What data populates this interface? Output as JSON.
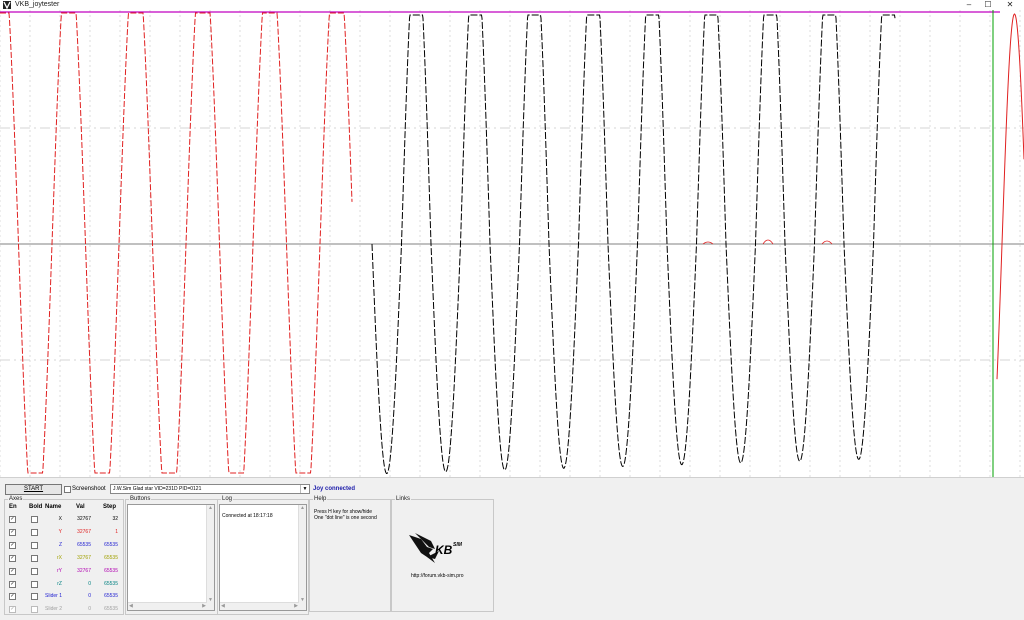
{
  "window": {
    "title": "VKB_joytester",
    "controls": [
      "–",
      "☐",
      "✕"
    ]
  },
  "plot": {
    "background": "#ffffff",
    "grid_color": "#c8c8c8",
    "axis_color": "#808080",
    "top_line_color": "#c000c0",
    "red_trace": "#e02020",
    "black_trace": "#000000",
    "cursor_color": "#00a000"
  },
  "toolbar": {
    "start_label": "START",
    "screenshot_label": "Screenshoot",
    "device_value": "J.W.Sim Glad star  VID=231D PID=0121",
    "status": "Joy connected"
  },
  "axes": {
    "title": "Axes",
    "headers": {
      "en": "En",
      "bold": "Bold",
      "name": "Name",
      "val": "Val",
      "step": "Step"
    },
    "rows": [
      {
        "en": "✓",
        "bold": "",
        "name": "X",
        "val": "32767",
        "step": "32",
        "color": "#000000",
        "disabled": false
      },
      {
        "en": "✓",
        "bold": "",
        "name": "Y",
        "val": "32767",
        "step": "1",
        "color": "#e02020",
        "disabled": false
      },
      {
        "en": "✓",
        "bold": "",
        "name": "Z",
        "val": "65535",
        "step": "65535",
        "color": "#1a1ad0",
        "disabled": false
      },
      {
        "en": "✓",
        "bold": "",
        "name": "rX",
        "val": "32767",
        "step": "65535",
        "color": "#a0a000",
        "disabled": false
      },
      {
        "en": "✓",
        "bold": "",
        "name": "rY",
        "val": "32767",
        "step": "65535",
        "color": "#b000b0",
        "disabled": false
      },
      {
        "en": "✓",
        "bold": "",
        "name": "rZ",
        "val": "0",
        "step": "65535",
        "color": "#008080",
        "disabled": false
      },
      {
        "en": "✓",
        "bold": "",
        "name": "Slider 1",
        "val": "0",
        "step": "65535",
        "color": "#1a1ad0",
        "disabled": false
      },
      {
        "en": "✓",
        "bold": "",
        "name": "Slider 2",
        "val": "0",
        "step": "65535",
        "color": "#a0a0a0",
        "disabled": true
      }
    ]
  },
  "buttons_group": {
    "title": "Buttons"
  },
  "log_group": {
    "title": "Log",
    "text": "Connected at 18:17:18"
  },
  "help_group": {
    "title": "Help",
    "lines": [
      "Press H key for show/hide",
      "One \"dot line\" is one second"
    ]
  },
  "links_group": {
    "title": "Links",
    "logo_text": "KB",
    "logo_sup": "SIM",
    "url": "http://forum.vkb-sim.pro"
  }
}
